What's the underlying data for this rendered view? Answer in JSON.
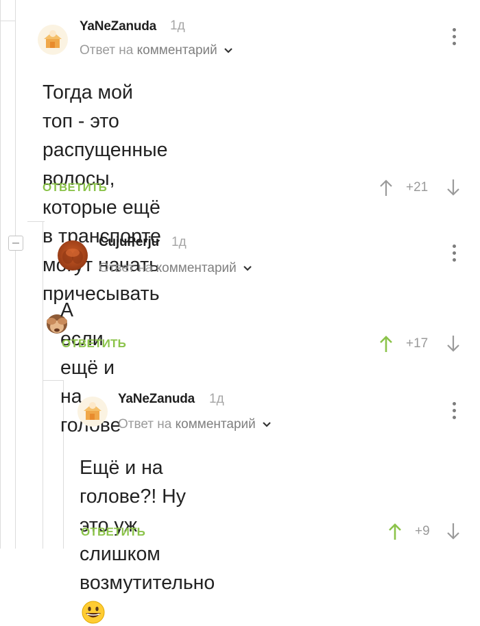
{
  "comments": [
    {
      "author": "YaNeZanuda",
      "time": "1д",
      "reply_prefix": "Ответ на",
      "reply_target": "комментарий",
      "text_lines": [
        "Тогда мой топ - это распущенные",
        "волосы, которые ещё в транспорте",
        "могут начать причесывать"
      ],
      "emoji": "see-no-evil-monkey",
      "reply_label": "ОТВЕТИТЬ",
      "score": "+21",
      "upvoted": false
    },
    {
      "author": "CujuPerju",
      "time": "1д",
      "reply_prefix": "Ответ на",
      "reply_target": "комментарий",
      "text_lines": [
        "А если ещё и на голове"
      ],
      "reply_label": "ОТВЕТИТЬ",
      "score": "+17",
      "upvoted": true
    },
    {
      "author": "YaNeZanuda",
      "time": "1д",
      "reply_prefix": "Ответ на",
      "reply_target": "комментарий",
      "text_lines": [
        "Ещё и на голове?! Ну это уж",
        "слишком возмутительно"
      ],
      "emoji": "grinning-face",
      "reply_label": "ОТВЕТИТЬ",
      "score": "+9",
      "upvoted": true
    }
  ],
  "colors": {
    "accent_green": "#8bc34a",
    "muted_gray": "#9a9a9a",
    "thread_line": "#dcdcdc"
  }
}
